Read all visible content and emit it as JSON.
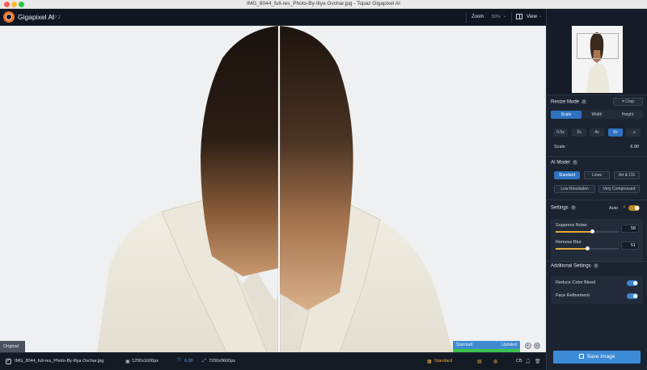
{
  "window": {
    "title": "IMG_8044_full-res_Photo-By-Illya Ovchar.jpg - Topaz Gigapixel AI"
  },
  "header": {
    "app_name": "Gigapixel AI",
    "version": "v5.7.2",
    "zoom_label": "Zoom",
    "zoom_value": "50%",
    "view_label": "View"
  },
  "canvas": {
    "original_label": "Original",
    "status_left": "Standard",
    "status_right": "Updated"
  },
  "filebar": {
    "filename": "IMG_8044_full-res_Photo-By-Illya Ovchar.jpg",
    "input_size": "1200x1600px",
    "scale": "6.00",
    "output_size": "7200x9600px",
    "model": "Standard",
    "format": "CB"
  },
  "panel": {
    "resize_mode": {
      "title": "Resize Mode",
      "crop_label": "Crop",
      "tabs": [
        "Scale",
        "Width",
        "Height"
      ],
      "active_tab": "Scale",
      "scale_options": [
        "0.5x",
        "2x",
        "4x",
        "6x",
        "..x"
      ],
      "active_scale": "6x",
      "scale_label": "Scale",
      "scale_value": "6.00"
    },
    "ai_model": {
      "title": "AI Model",
      "row1": [
        "Standard",
        "Lines",
        "Art & CG"
      ],
      "row2": [
        "Low Resolution",
        "Very Compressed"
      ],
      "active": "Standard"
    },
    "settings": {
      "title": "Settings",
      "auto_label": "Auto",
      "auto_on": true,
      "suppress_noise_label": "Suppress Noise",
      "suppress_noise_value": "58",
      "suppress_noise_level": 58,
      "remove_blur_label": "Remove Blur",
      "remove_blur_value": "51",
      "remove_blur_level": 51
    },
    "additional": {
      "title": "Additional Settings",
      "reduce_color_bleed_label": "Reduce Color Bleed",
      "reduce_color_bleed_on": true,
      "face_refinement_label": "Face Refinement",
      "face_refinement_on": true
    },
    "save_label": "Save Image"
  },
  "colors": {
    "accent": "#3d8bd6",
    "slider": "#e5a83a",
    "status_green": "#3fc24d",
    "logo": "#e8742b"
  }
}
